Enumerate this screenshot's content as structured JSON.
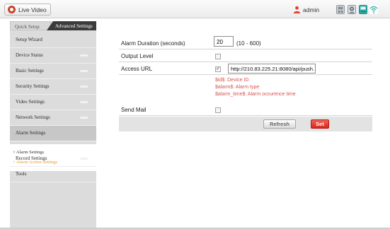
{
  "topbar": {
    "live_video_label": "Live Video",
    "user_name": "admin",
    "icons": [
      "user-icon",
      "record-icon",
      "snapshot-icon",
      "storage-icon",
      "wifi-icon"
    ]
  },
  "sidebar": {
    "tabs": {
      "quick_setup": "Quick Setup",
      "advanced_settings": "Advanced Settings"
    },
    "items": [
      {
        "label": "Setup Wizard",
        "expandable": false
      },
      {
        "label": "Device Status",
        "expandable": true
      },
      {
        "label": "Basic Settings",
        "expandable": true
      },
      {
        "label": "Security Settings",
        "expandable": true
      },
      {
        "label": "Video Settings",
        "expandable": true
      },
      {
        "label": "Network Settings",
        "expandable": true
      },
      {
        "label": "Alarm Settings",
        "expandable": false
      },
      {
        "label": "Record Settings",
        "expandable": true
      },
      {
        "label": "Tools",
        "expandable": false
      }
    ],
    "subitems": [
      {
        "label": "> Alarm Settings",
        "selected": false
      },
      {
        "label": "> Alarm Action Settings",
        "selected": true
      }
    ]
  },
  "form": {
    "alarm_duration": {
      "label": "Alarm Duration (seconds)",
      "value": "20",
      "range_hint": "(10 - 600)"
    },
    "output_level": {
      "label": "Output Level",
      "checked": false
    },
    "access_url": {
      "label": "Access URL",
      "checked": true,
      "value": "http://210.83.225.21:8080/api/push."
    },
    "hints": [
      "$id$: Device ID",
      "$alarm$: Alarm type",
      "$alarm_time$: Alarm occurence time"
    ],
    "send_mail": {
      "label": "Send Mail",
      "checked": false
    }
  },
  "buttons": {
    "refresh": "Refresh",
    "set": "Set"
  },
  "colors": {
    "hint_text": "#d9534f",
    "set_button": "#e0382b",
    "selected_subitem": "#e89a3c",
    "sidebar_bg": "#dcdcdc",
    "tab_active_bg": "#3b3b3b"
  }
}
